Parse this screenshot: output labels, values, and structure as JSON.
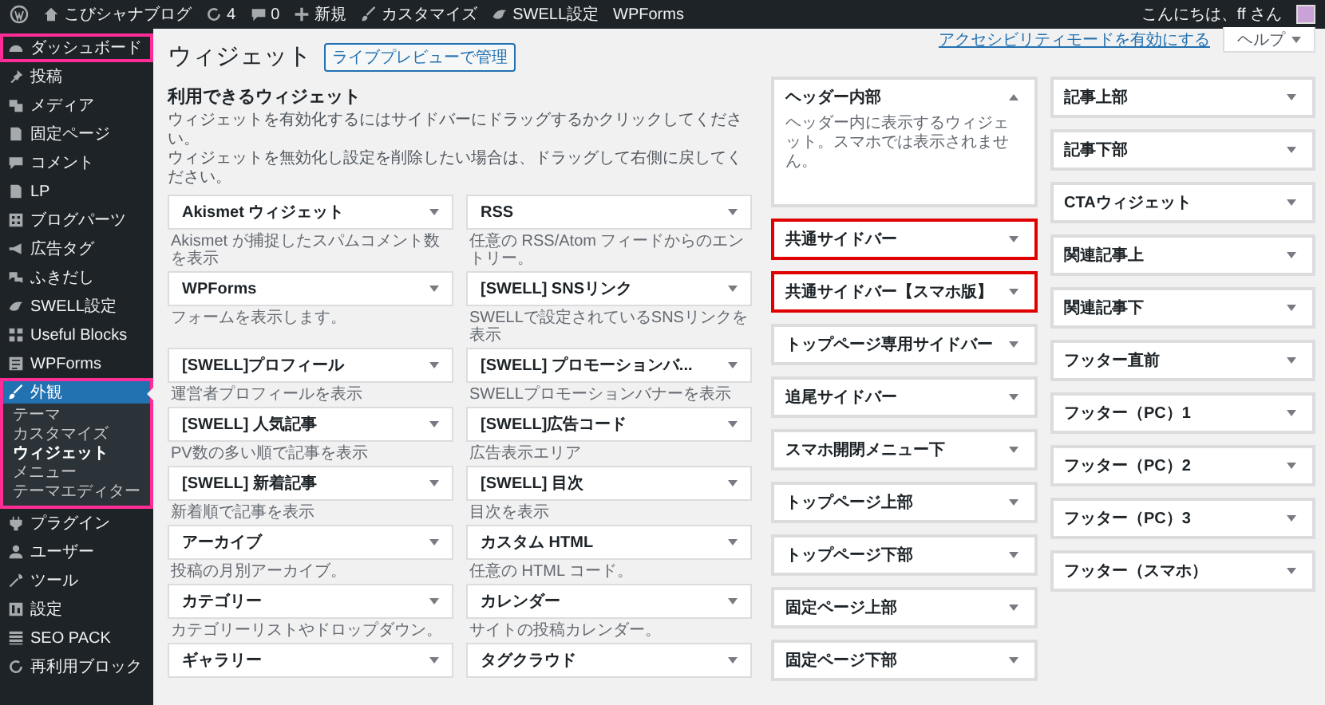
{
  "admin_bar": {
    "items": [
      {
        "kind": "home",
        "label": "こびシャナブログ"
      },
      {
        "kind": "updates",
        "label": "4"
      },
      {
        "kind": "comments",
        "label": "0"
      },
      {
        "kind": "new",
        "label": "新規"
      },
      {
        "kind": "brush",
        "label": "カスタマイズ"
      },
      {
        "kind": "bird",
        "label": "SWELL設定"
      },
      {
        "kind": "text",
        "label": "WPForms"
      }
    ],
    "greeting": "こんにちは、ff さん"
  },
  "menu": [
    {
      "label": "ダッシュボード",
      "kind": "gauge",
      "selected": false,
      "highlighted": true
    },
    {
      "label": "投稿",
      "kind": "pin",
      "selected": false,
      "highlighted": false
    },
    {
      "label": "メディア",
      "kind": "media",
      "selected": false,
      "highlighted": false
    },
    {
      "label": "固定ページ",
      "kind": "page",
      "selected": false,
      "highlighted": false
    },
    {
      "label": "コメント",
      "kind": "comment",
      "selected": false,
      "highlighted": false
    },
    {
      "label": "LP",
      "kind": "page",
      "selected": false,
      "highlighted": false
    },
    {
      "label": "ブログパーツ",
      "kind": "grid",
      "selected": false,
      "highlighted": false
    },
    {
      "label": "広告タグ",
      "kind": "tag",
      "selected": false,
      "highlighted": false
    },
    {
      "label": "ふきだし",
      "kind": "bubble",
      "selected": false,
      "highlighted": false
    },
    {
      "label": "SWELL設定",
      "kind": "bird",
      "selected": false,
      "highlighted": false
    },
    {
      "label": "Useful Blocks",
      "kind": "blocks",
      "selected": false,
      "highlighted": false
    },
    {
      "label": "WPForms",
      "kind": "form",
      "selected": false,
      "highlighted": false
    },
    {
      "label": "外観",
      "kind": "brush",
      "selected": true,
      "highlighted": true,
      "children": [
        {
          "label": "テーマ",
          "selected": false
        },
        {
          "label": "カスタマイズ",
          "selected": false
        },
        {
          "label": "ウィジェット",
          "selected": true
        },
        {
          "label": "メニュー",
          "selected": false
        },
        {
          "label": "テーマエディター",
          "selected": false
        }
      ]
    },
    {
      "label": "プラグイン",
      "kind": "plug",
      "selected": false,
      "highlighted": false
    },
    {
      "label": "ユーザー",
      "kind": "user",
      "selected": false,
      "highlighted": false
    },
    {
      "label": "ツール",
      "kind": "wrench",
      "selected": false,
      "highlighted": false
    },
    {
      "label": "設定",
      "kind": "settings",
      "selected": false,
      "highlighted": false
    },
    {
      "label": "SEO PACK",
      "kind": "list",
      "selected": false,
      "highlighted": false
    },
    {
      "label": "再利用ブロック",
      "kind": "reuse",
      "selected": false,
      "highlighted": false
    }
  ],
  "screen_meta": {
    "link": "アクセシビリティモードを有効にする",
    "help": "ヘルプ"
  },
  "page": {
    "title": "ウィジェット",
    "manage_button": "ライブプレビューで管理"
  },
  "available": {
    "title": "利用できるウィジェット",
    "intro": [
      "ウィジェットを有効化するにはサイドバーにドラッグするかクリックしてください。",
      "ウィジェットを無効化し設定を削除したい場合は、ドラッグして右側に戻してください。"
    ],
    "widgets": [
      {
        "title": "Akismet ウィジェット",
        "description": "Akismet が捕捉したスパムコメント数を表示"
      },
      {
        "title": "RSS",
        "description": "任意の RSS/Atom フィードからのエントリー。"
      },
      {
        "title": "WPForms",
        "description": "フォームを表示します。"
      },
      {
        "title": "[SWELL] SNSリンク",
        "description": "SWELLで設定されているSNSリンクを表示"
      },
      {
        "title": "[SWELL]プロフィール",
        "description": "運営者プロフィールを表示"
      },
      {
        "title": "[SWELL] プロモーションバ...",
        "description": "SWELLプロモーションバナーを表示"
      },
      {
        "title": "[SWELL] 人気記事",
        "description": "PV数の多い順で記事を表示"
      },
      {
        "title": "[SWELL]広告コード",
        "description": "広告表示エリア"
      },
      {
        "title": "[SWELL] 新着記事",
        "description": "新着順で記事を表示"
      },
      {
        "title": "[SWELL] 目次",
        "description": "目次を表示"
      },
      {
        "title": "アーカイブ",
        "description": "投稿の月別アーカイブ。"
      },
      {
        "title": "カスタム HTML",
        "description": "任意の HTML コード。"
      },
      {
        "title": "カテゴリー",
        "description": "カテゴリーリストやドロップダウン。"
      },
      {
        "title": "カレンダー",
        "description": "サイトの投稿カレンダー。"
      },
      {
        "title": "ギャラリー"
      },
      {
        "title": "タグクラウド"
      }
    ]
  },
  "sidebars": [
    [
      {
        "title": "ヘッダー内部",
        "expanded": true,
        "highlighted": false,
        "description": "ヘッダー内に表示するウィジェット。スマホでは表示されません。"
      },
      {
        "title": "共通サイドバー",
        "expanded": false,
        "highlighted": true
      },
      {
        "title": "共通サイドバー【スマホ版】",
        "expanded": false,
        "highlighted": true
      },
      {
        "title": "トップページ専用サイドバー",
        "expanded": false,
        "highlighted": false
      },
      {
        "title": "追尾サイドバー",
        "expanded": false,
        "highlighted": false
      },
      {
        "title": "スマホ開閉メニュー下",
        "expanded": false,
        "highlighted": false
      },
      {
        "title": "トップページ上部",
        "expanded": false,
        "highlighted": false
      },
      {
        "title": "トップページ下部",
        "expanded": false,
        "highlighted": false
      },
      {
        "title": "固定ページ上部",
        "expanded": false,
        "highlighted": false
      },
      {
        "title": "固定ページ下部",
        "expanded": false,
        "highlighted": false
      }
    ],
    [
      {
        "title": "記事上部",
        "expanded": false,
        "highlighted": false
      },
      {
        "title": "記事下部",
        "expanded": false,
        "highlighted": false
      },
      {
        "title": "CTAウィジェット",
        "expanded": false,
        "highlighted": false
      },
      {
        "title": "関連記事上",
        "expanded": false,
        "highlighted": false
      },
      {
        "title": "関連記事下",
        "expanded": false,
        "highlighted": false
      },
      {
        "title": "フッター直前",
        "expanded": false,
        "highlighted": false
      },
      {
        "title": "フッター（PC）1",
        "expanded": false,
        "highlighted": false
      },
      {
        "title": "フッター（PC）2",
        "expanded": false,
        "highlighted": false
      },
      {
        "title": "フッター（PC）3",
        "expanded": false,
        "highlighted": false
      },
      {
        "title": "フッター（スマホ）",
        "expanded": false,
        "highlighted": false
      }
    ]
  ]
}
